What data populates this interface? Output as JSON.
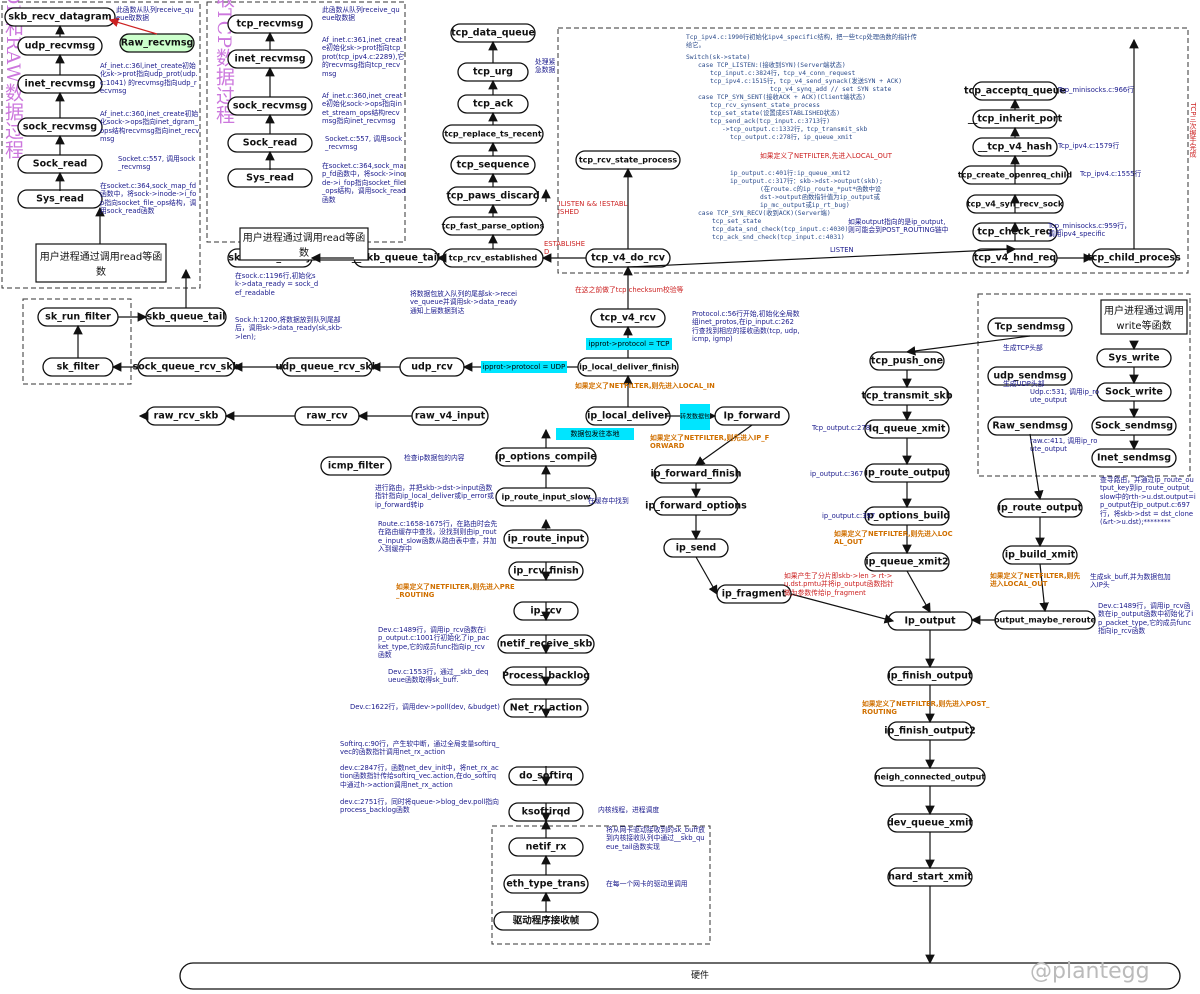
{
  "titles": {
    "udp_raw": "用户接收UDP和RAW数据过程",
    "tcp_recv": "用户接收TCP数据过程",
    "tcp_handshake": "TCP三次握手完成"
  },
  "nodes": {
    "skb_recv_datagram": "skb_recv_datagram",
    "udp_recvmsg": "udp_recvmsg",
    "raw_recvmsg": "Raw_recvmsg",
    "inet_recvmsg_u": "inet_recvmsg",
    "sock_recvmsg_u": "sock_recvmsg",
    "sock_read_u": "Sock_read",
    "sys_read_u": "Sys_read",
    "user_read_u": "用户进程通过调用read等函数",
    "tcp_recvmsg": "tcp_recvmsg",
    "inet_recvmsg_t": "inet_recvmsg",
    "sock_recvmsg_t": "sock_recvmsg",
    "sock_read_t": "Sock_read",
    "sys_read_t": "Sys_read",
    "user_read_t": "用户进程通过调用read等函数",
    "tcp_data_queue": "tcp_data_queue",
    "tcp_urg": "tcp_urg",
    "tcp_ack": "tcp_ack",
    "tcp_replace_ts_recent": "tcp_replace_ts_recent",
    "tcp_sequence": "tcp_sequence",
    "tcp_paws_discard": "tcp_paws_discard",
    "tcp_fast_parse_options": "tcp_fast_parse_options",
    "tcp_rcv_established": "tcp_rcv_established",
    "skb_queue_tail_top": "__skb_queue_tail",
    "sk_data_ready": "sk->data_ready",
    "tcp_rcv_state_process": "tcp_rcv_state_process",
    "tcp_v4_do_rcv": "tcp_v4_do_rcv",
    "tcp_acceptq_queue": "tcp_acceptq_queue",
    "inherit_port": "__tcp_inherit_port",
    "v4_hash": "__tcp_v4_hash",
    "create_openreq_child": "tcp_create_openreq_child",
    "syn_recv_sock": "tcp_v4_syn_recv_sock",
    "tcp_check_req": "tcp_check_req",
    "tcp_v4_hnd_req": "tcp_v4_hnd_req",
    "tcp_child_process": "tcp_child_process",
    "sk_run_filter": "sk_run_filter",
    "skb_queue_tail_mid": "skb_queue_tail",
    "sk_filter": "sk_filter",
    "sock_queue_rcv_skb": "sock_queue_rcv_skb",
    "udp_queue_rcv_skb": "udp_queue_rcv_skb",
    "udp_rcv": "udp_rcv",
    "tcp_v4_rcv": "tcp_v4_rcv",
    "ip_local_deliver_finish": "ip_local_deliver_finish",
    "raw_rcv_skb": "raw_rcv_skb",
    "raw_rcv": "raw_rcv",
    "raw_v4_input": "raw_v4_input",
    "icmp_filter": "icmp_filter",
    "ip_local_deliver": "ip_local_deliver",
    "ip_forward": "Ip_forward",
    "ip_options_compile": "ip_options_compile",
    "ip_route_input_slow": "ip_route_input_slow",
    "ip_route_input": "ip_route_input",
    "ip_rcv_finish": "ip_rcv_finish",
    "ip_rcv": "ip_rcv",
    "netif_receive_skb": "netif_receive_skb",
    "process_backlog": "Process_backlog",
    "net_rx_action": "Net_rx_action",
    "do_softirq": "do_softirq",
    "ksoftirqd": "ksoftirqd",
    "netif_rx": "netif_rx",
    "eth_type_trans": "eth_type_trans",
    "driver_recv": "驱动程序接收帧",
    "ip_forward_finish": "ip_forward_finish",
    "ip_forward_options": "ip_forward_options",
    "ip_send": "ip_send",
    "ip_fragment": "ip_fragment",
    "tcp_push_one": "tcp_push_one",
    "tcp_transmit_skb": "tcp_transmit_skb",
    "lq_queue_xmit": "Iq_queue_xmit",
    "ip_route_output_l": "ip_route_output",
    "ip_options_build": "ip_options_build",
    "ip_queue_xmit2": "ip_queue_xmit2",
    "ip_output": "Ip_output",
    "ip_finish_output": "ip_finish_output",
    "ip_finish_output2": "ip_finish_output2",
    "neigh_connected_output": "neigh_connected_output",
    "dev_queue_xmit": "dev_queue_xmit",
    "hard_start_xmit": "hard_start_xmit",
    "user_write": "用户进程通过调用write等函数",
    "tcp_sendmsg": "Tcp_sendmsg",
    "udp_sendmsg": "udp_sendmsg",
    "raw_sendmsg": "Raw_sendmsg",
    "sys_write": "Sys_write",
    "sock_write": "Sock_write",
    "sock_sendmsg": "Sock_sendmsg",
    "inet_sendmsg": "Inet_sendmsg",
    "ip_route_output_r": "ip_route_output",
    "ip_build_xmit": "ip_build_xmit",
    "output_maybe_reroute": "output_maybe_reroute",
    "hardware": "硬件"
  },
  "notes": {
    "n_queue": "此函数从队列receive_queue取数据",
    "n_af_udp": "Af_inet.c:36l,inet_create初始化sk->prot指向udp_prot(udp.c:1041) 的recvmsg指向udp_recvmsg",
    "n_af_udp2": "Af_inet.c:360,inet_create初始化sock->ops指向inet_dgram_ops结构recvmsg指向inet_recvmsg",
    "n_sock557": "Socket.c:557, 调用sock_recvmsg",
    "n_sock364": "在socket.c:364,sock_map_fd函数中，将sock->inode->i_fop指向socket_file_ops结构，调用sock_read函数",
    "n_tq": "此函数从队列receive_queue取数据",
    "n_af_tcp": "Af_inet.c:361,inet_create初始化sk->prot指向tcp_prot(tcp_ipv4.c:2289),它的recvmsg指向tcp_recvmsg",
    "n_af_tcp2": "Af_inet.c:360,inet_create初始化sock->ops指向inet_stream_ops结构recvmsg指向inet_recvmsg",
    "n_sock557t": "Socket.c:557, 调用sock_recvmsg",
    "n_sock364t": "在socket.c:364,sock_map_fd函数中，将sock->inode->i_fop指向socket_file_ops结构，调用sock_read函数",
    "n_urg": "处理紧急数据",
    "n_state1": "Tcp_ipv4.c:1990行初始化ipv4_specific结构，把一些tcp处理函数的指针传给它。",
    "n_state2": "Switch(sk->state)",
    "n_state3": "case TCP_LISTEN:(接收到SYN)(Server端状态)",
    "n_state4": "tcp_input.c:3824行，tcp_v4_conn_request",
    "n_state5": "tcp_ipv4.c:1515行，tcp_v4_send_synack(发送SYN + ACK)",
    "n_state6": "tcp_v4_synq_add // set SYN state",
    "n_state7": "case TCP_SYN_SENT(接收ACK + ACK)(Client端状态)",
    "n_state8": "tcp_rcv_synsent_state_process",
    "n_state9": "tcp_set_state(设置成ESTABLISHED状态)",
    "n_state10": "tcp_send_ack(tcp_input.c:3713行)",
    "n_state11": "->tcp_output.c:1332行，tcp_transmit_skb",
    "n_state12": "tcp_output.c:278行，ip_queue_xmit",
    "n_state13": "如果定义了NETFILTER,先进入LOCAL_OUT",
    "n_state14": "ip_output.c:401行:ip_queue_xmit2",
    "n_state15": "ip_output.c:317行：skb->dst->output(skb);",
    "n_state16": "(在route.c的ip_route_*put*函数中设",
    "n_state17": "dst->output函数指针值为ip_output或",
    "n_state18": "ip_mc_output或ip_rt_bug)",
    "n_state19": "case TCP_SYN_RECV(收到ACK)(Server端)",
    "n_state20": "tcp_set_state",
    "n_state21": "tcp_data_snd_check(tcp_input.c:4030)",
    "n_state22": "tcp_ack_snd_check(tcp_input.c:4031)",
    "n_cloud": "如果output指向的是ip_output,则可能会到POST_ROUTING链中",
    "n_listen_not": "!LISTEN && !ESTABLISHED",
    "n_established": "ESTABLISHED",
    "n_listen": "LISTEN",
    "n_checksum": "在这之前做了tcp checksum校验等",
    "n_minisocks966": "Tcp_minisocks.c:966行",
    "n_ipv4_1579": "Tcp_ipv4.c:1579行",
    "n_ipv4_1555": "Tcp_ipv4.c:1555行",
    "n_minisocks959": "Tcp_minisocks.c:959行，调用ipv4_specific",
    "n_sock1196": "在sock.c:1196行,初始化sk->data_ready = sock_def_readable",
    "n_cloud2": "将数据包放入队列的尾部sk->receive_queue并调用sk->data_ready通知上层数据到达",
    "n_sockh1200": "Sock.h:1200,将数据放到队列尾部后，调用sk->data_ready(sk,skb->len);",
    "n_protocol": "Protocol.c:56行开始,初始化全局数组inet_protos,在ip_input.c:262行查找到相应的接收函数(tcp, udp, icmp, igmp)",
    "tag_tcp": "ipprot->protocol = TCP",
    "tag_udp": "ipprot->protocol = UDP",
    "n_local_in": "如果定义了NETFILTER,则先进入LOCAL_IN",
    "tag_fwd": "转发数据包",
    "tag_local": "数据包发往本地",
    "n_fwd_filter": "如果定义了NETFILTER,则先进入IP_FORWARD",
    "n_icmp": "检查ip数据包的内容",
    "n_route_in": "进行路由，并把skb->dst->input函数指针指向ip_local_deliver或ip_error或ip_forward转ip",
    "n_cache": "在缓存中找到",
    "n_route_c": "Route.c:1658-1675行，在路由时会先在路由缓存中查找，没找到则由ip_route_input_slow函数从路由表中查，并加入到缓存中",
    "n_pre": "如果定义了NETFILTER,则先进入PRE_ROUTING",
    "n_dev1489": "Dev.c:1489行，调用ip_rcv函数在ip_output.c:1001行初始化了ip_packet_type,它的成员func指向ip_rcv函数",
    "n_dev1553": "Dev.c:1553行，通过__skb_dequeue函数取得sk_buff.",
    "n_dev1622": "Dev.c:1622行，调用dev->poll(dev, &budget)",
    "n_softirq1": "Softirq.c:90行，产生软中断，通过全局变量softirq_vec的函数指针调用net_rx_action",
    "n_softirq2": "dev.c:2847行，函数net_dev_init中，将net_rx_action函数指针传给softirq_vec.action,在do_softirq中通过h->action调用net_rx_action",
    "n_softirq3": "dev.c:2751行，同时将queue->blog_dev.poll指向process_backlog函数",
    "n_kthread": "内核线程，进程调度",
    "n_netif": "将从网卡驱动接收到的sk_buff放到内核接收队列中通过__skb_queue_tail函数实现",
    "n_each": "在每一个网卡的驱动里调用",
    "n_tcp_hdr": "生成TCP头部",
    "n_udp_hdr": "生成UDP头部",
    "n_udp531": "Udp.c:531, 调用ip_route_output",
    "n_raw411": "raw.c:411, 调用ip_route_output",
    "n_tcp_out278": "Tcp_output.c:278",
    "n_ipout367": "ip_output.c:367",
    "n_ipout397": "ip_output.c:397",
    "n_local_out": "如果定义了NETFILTER,则先进入LOCAL_OUT",
    "n_frag": "如果产生了分片即skb->len > rt->u.dst.pmtu并将ip_output函数指针做为参数传给ip_fragment",
    "n_lookup": "查寻路由，并通过ip_route_output_key到ip_route_output_slow中的rth->u.dst.output=ip_output在ip_output.c:697行，将skb->dst = dst_clone(&rt->u.dst);********",
    "n_build": "生成sk_buff,并为数据包加入IP头",
    "n_local_out2": "如果定义了NETFILTER,则先进入LOCAL_OUT",
    "n_dev1489b": "Dev.c:1489行，调用ip_rcv函数在ip_output函数中初始化了ip_packet_type,它的成员func指向ip_rcv函数",
    "n_post": "如果定义了NETFILTER,则先进入POST_ROUTING",
    "watermark": "@plantegg"
  }
}
